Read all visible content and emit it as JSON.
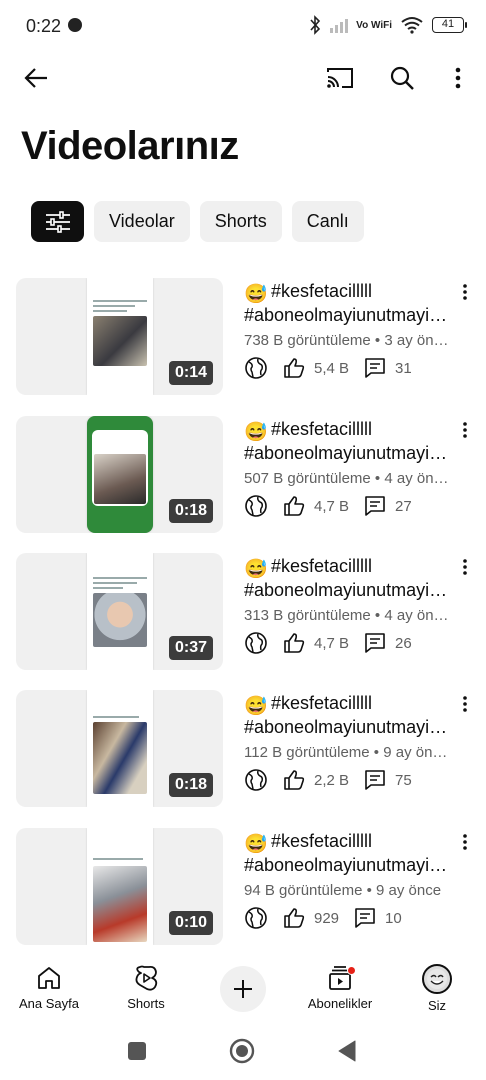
{
  "status_bar": {
    "time": "0:22",
    "network": "Vo WiFi",
    "wifi_label": "6",
    "battery": "41"
  },
  "app_bar": {
    "icons": [
      "back-arrow-icon",
      "cast-icon",
      "search-icon",
      "more-vertical-icon"
    ]
  },
  "page": {
    "title": "Videolarınız"
  },
  "chips": [
    {
      "label": "Videolar"
    },
    {
      "label": "Shorts"
    },
    {
      "label": "Canlı"
    }
  ],
  "videos": [
    {
      "emoji": "😅",
      "title_line1": "#kesfetacilllll",
      "title_line2": "#aboneolmayiunutmayi…",
      "meta": "738 B görüntüleme • 3 ay ön…",
      "likes": "5,4 B",
      "comments": "31",
      "duration": "0:14"
    },
    {
      "emoji": "😅",
      "title_line1": "#kesfetacilllll",
      "title_line2": "#aboneolmayiunutmayi…",
      "meta": "507 B görüntüleme • 4 ay ön…",
      "likes": "4,7 B",
      "comments": "27",
      "duration": "0:18"
    },
    {
      "emoji": "😅",
      "title_line1": "#kesfetacilllll",
      "title_line2": "#aboneolmayiunutmayi…",
      "meta": "313 B görüntüleme • 4 ay ön…",
      "likes": "4,7 B",
      "comments": "26",
      "duration": "0:37"
    },
    {
      "emoji": "😅",
      "title_line1": "#kesfetacilllll",
      "title_line2": "#aboneolmayiunutmayi…",
      "meta": "112 B görüntüleme • 9 ay ön…",
      "likes": "2,2 B",
      "comments": "75",
      "duration": "0:18"
    },
    {
      "emoji": "😅",
      "title_line1": "#kesfetacilllll",
      "title_line2": "#aboneolmayiunutmayi…",
      "meta": "94 B görüntüleme • 9 ay önce",
      "likes": "929",
      "comments": "10",
      "duration": "0:10"
    }
  ],
  "bottom_nav": {
    "home": "Ana Sayfa",
    "shorts": "Shorts",
    "subscriptions": "Abonelikler",
    "you": "Siz"
  },
  "colors": {
    "accent_red": "#e62117",
    "chip_bg": "#f0f0f0",
    "text_secondary": "#606060"
  }
}
